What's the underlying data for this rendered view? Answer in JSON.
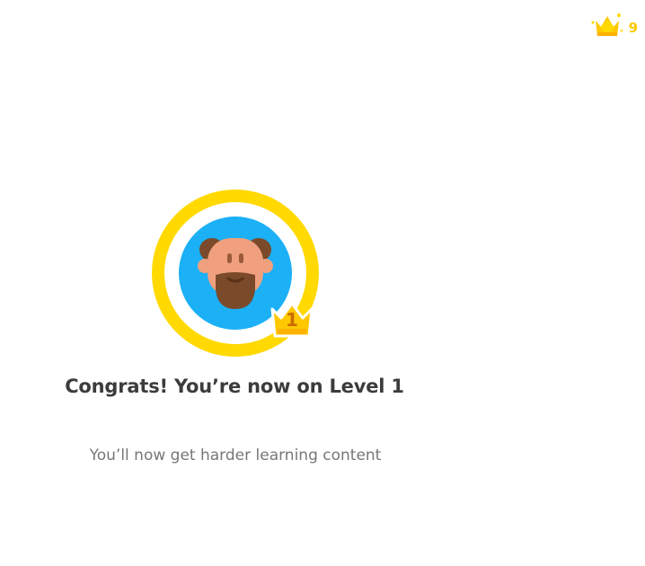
{
  "header": {
    "crown_count": "9",
    "crown_icon": "crown-icon"
  },
  "avatar": {
    "ring_color": "#ffd900",
    "bg_color": "#1cb0f6",
    "badge_level": "1"
  },
  "main": {
    "title": "Congrats! You’re now on Level 1",
    "subtitle": "You’ll now get harder learning content"
  }
}
